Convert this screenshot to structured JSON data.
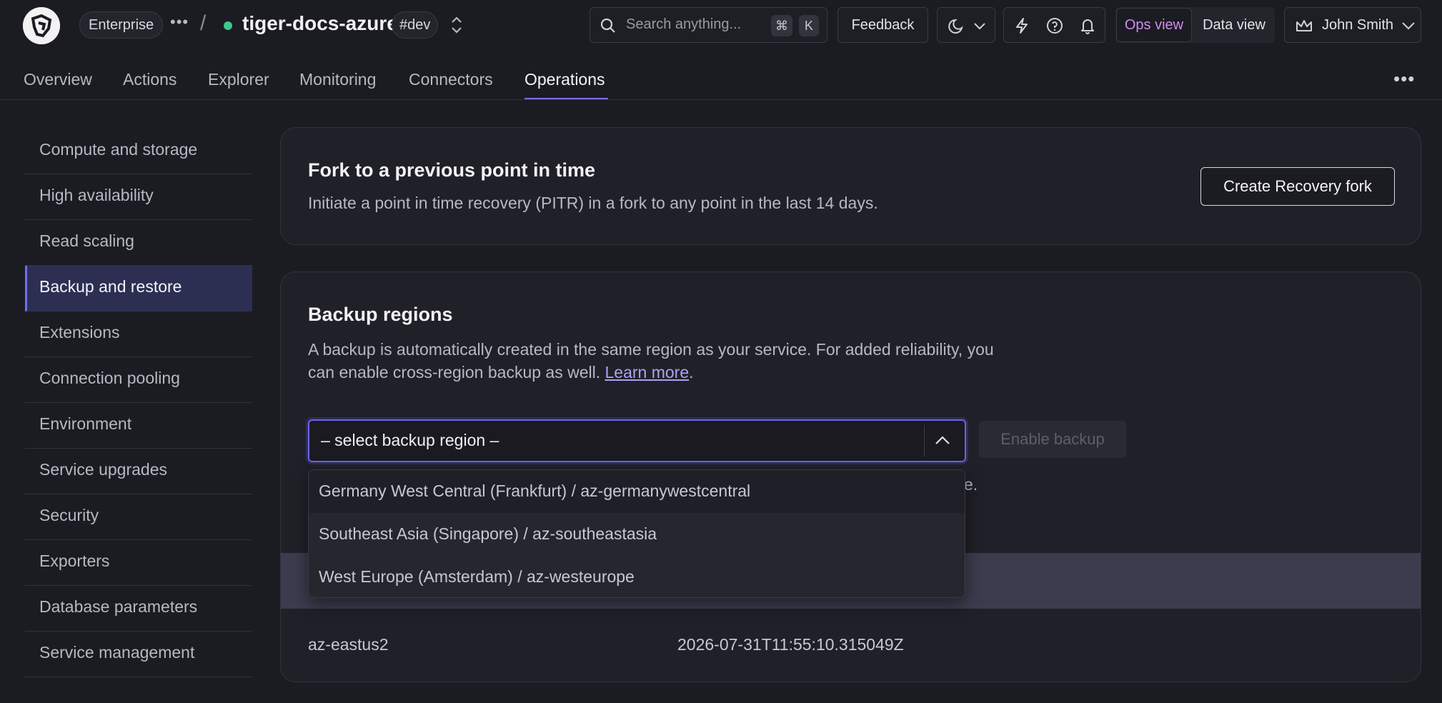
{
  "header": {
    "plan_badge": "Enterprise",
    "more_label": "•••",
    "separator": "/",
    "service_name": "tiger-docs-azure",
    "env_badge": "#dev",
    "search_placeholder": "Search anything...",
    "search_kbd_1": "⌘",
    "search_kbd_2": "K",
    "feedback_label": "Feedback",
    "ops_view_label": "Ops view",
    "data_view_label": "Data view",
    "user_name": "John Smith"
  },
  "nav": {
    "tabs": [
      {
        "label": "Overview"
      },
      {
        "label": "Actions"
      },
      {
        "label": "Explorer"
      },
      {
        "label": "Monitoring"
      },
      {
        "label": "Connectors"
      },
      {
        "label": "Operations"
      }
    ],
    "active_tab": "Operations",
    "more_label": "•••"
  },
  "sidebar": {
    "items": [
      {
        "label": "Compute and storage"
      },
      {
        "label": "High availability"
      },
      {
        "label": "Read scaling"
      },
      {
        "label": "Backup and restore"
      },
      {
        "label": "Extensions"
      },
      {
        "label": "Connection pooling"
      },
      {
        "label": "Environment"
      },
      {
        "label": "Service upgrades"
      },
      {
        "label": "Security"
      },
      {
        "label": "Exporters"
      },
      {
        "label": "Database parameters"
      },
      {
        "label": "Service management"
      }
    ],
    "active_item": "Backup and restore"
  },
  "fork_card": {
    "title": "Fork to a previous point in time",
    "description": "Initiate a point in time recovery (PITR) in a fork to any point in the last 14 days.",
    "button_label": "Create Recovery fork"
  },
  "backup_card": {
    "title": "Backup regions",
    "description_1": "A backup is automatically created in the same region as your service. For added reliability, you can enable cross-region backup as well. ",
    "learn_more": "Learn more",
    "description_end": ".",
    "select_value": "– select backup region –",
    "enable_button": "Enable backup",
    "obscured_tail": "e.",
    "table_rows": [
      {
        "region": "az-eastus2",
        "timestamp": "2026-07-31T11:55:10.315049Z"
      }
    ]
  },
  "dropdown": {
    "options": [
      {
        "label": "Germany West Central (Frankfurt) / az-germanywestcentral"
      },
      {
        "label": "Southeast Asia (Singapore) / az-southeastasia"
      },
      {
        "label": "West Europe (Amsterdam) / az-westeurope"
      }
    ]
  },
  "colors": {
    "background": "#1b1b22",
    "accent": "#7c6cf0",
    "active_sidebar": "#2c2f52",
    "status_green": "#3cc98a",
    "ops_view_text": "#d18cf0",
    "link": "#a9a2f5"
  }
}
